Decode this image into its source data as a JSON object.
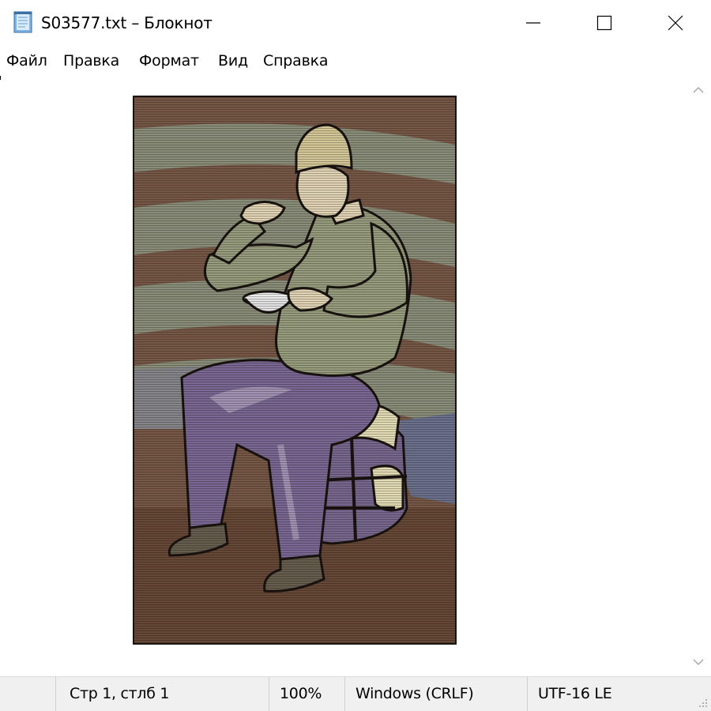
{
  "window": {
    "title": "S03577.txt – Блокнот",
    "icon": "notepad-icon",
    "controls": [
      "minimize-icon",
      "maximize-icon",
      "close-icon"
    ]
  },
  "menu": {
    "items": [
      {
        "label": "Файл"
      },
      {
        "label": "Правка"
      },
      {
        "label": "Формат"
      },
      {
        "label": "Вид"
      },
      {
        "label": "Справка"
      }
    ]
  },
  "editor": {
    "content": "ascii-art-man-eating-from-bowl",
    "palette": {
      "outline": "#1a1410",
      "brown_stripe": "#7a5a48",
      "olive_stripe": "#8e917c",
      "sweater": "#9aa080",
      "trousers": "#7e6a96",
      "trousers_light": "#a896b8",
      "hat": "#d9cc9c",
      "skin": "#e6d8b8",
      "bag_cream": "#e8e0b8",
      "bag_purple": "#7a6a92",
      "rock": "#6e7490",
      "floor": "#6a4a38"
    }
  },
  "scrollbar": {
    "up": "chevron-up-icon",
    "down": "chevron-down-icon"
  },
  "status": {
    "position": "Стр 1, стлб 1",
    "zoom": "100%",
    "line_endings": "Windows (CRLF)",
    "encoding": "UTF-16 LE"
  }
}
